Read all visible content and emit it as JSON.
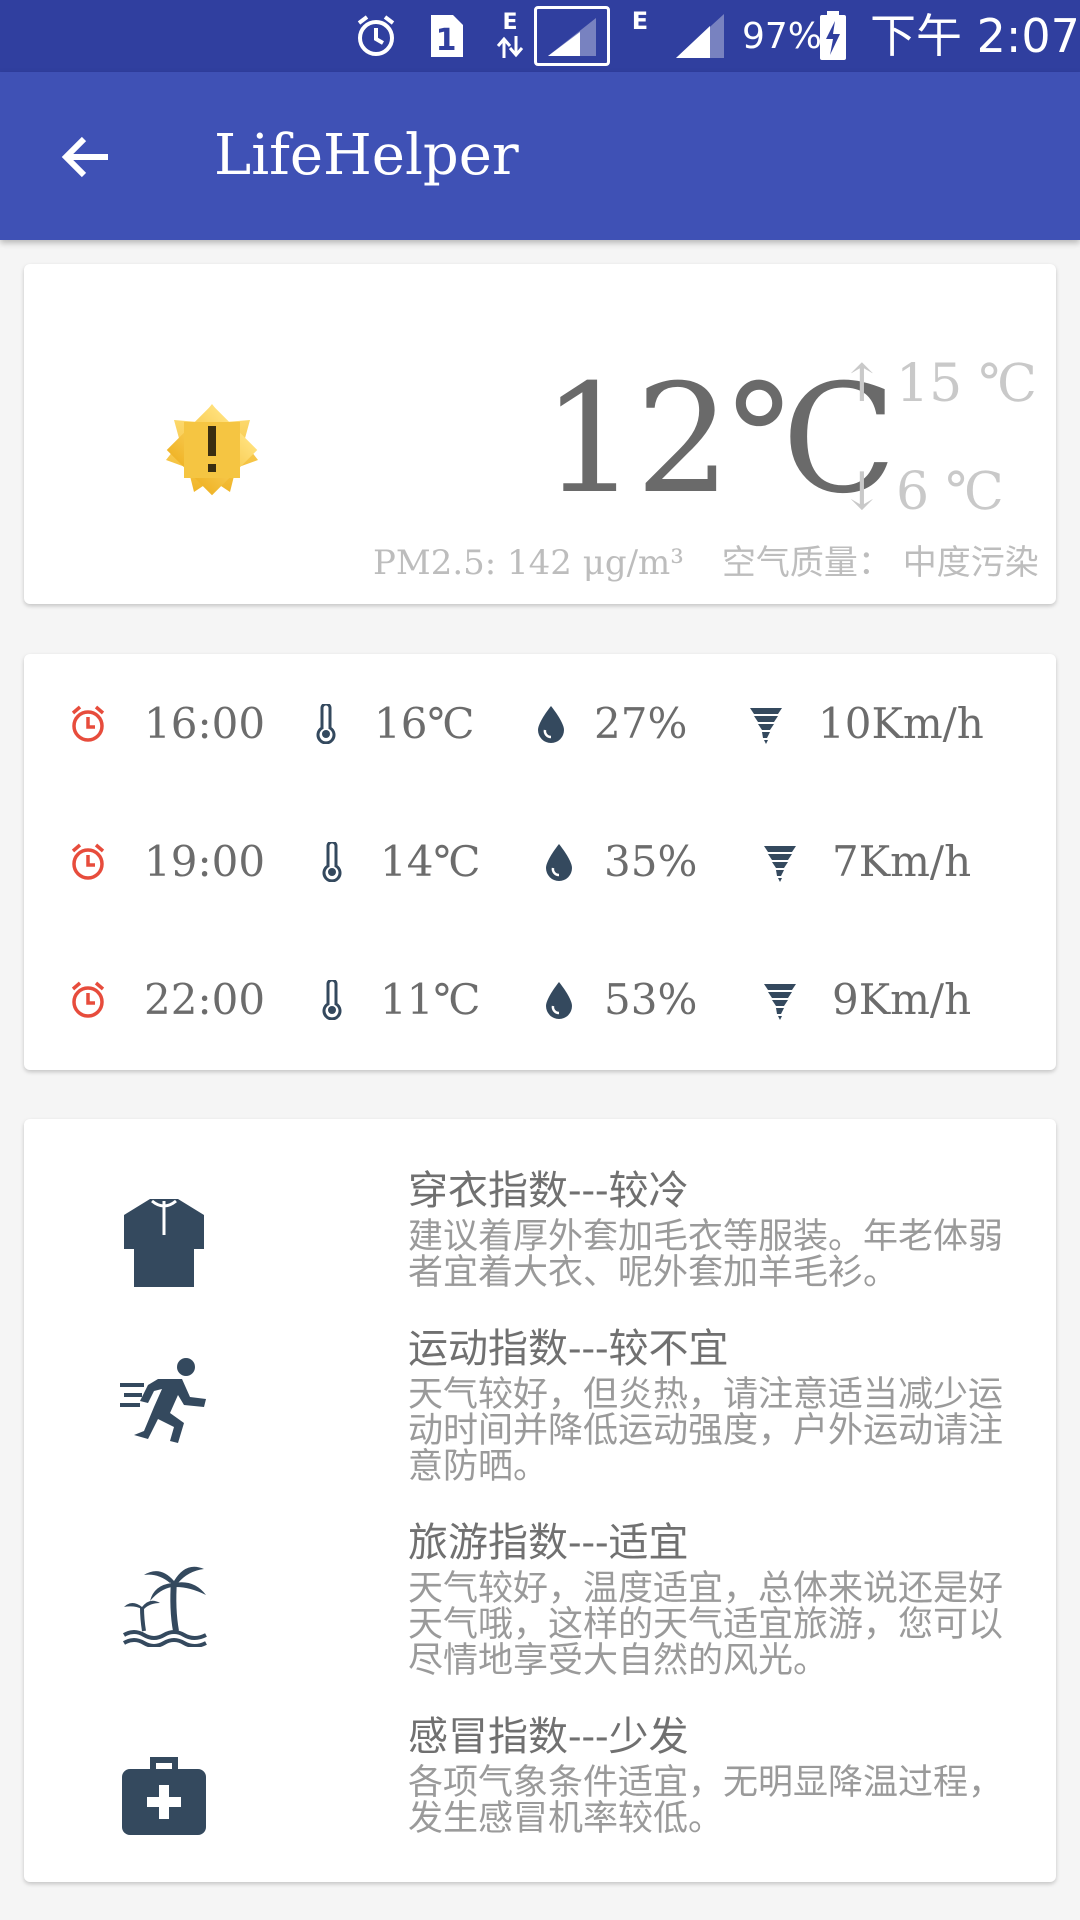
{
  "status_bar": {
    "sim_label": "1",
    "net_type_1": "E",
    "net_type_2": "E",
    "battery": "97%",
    "time": "下午 2:07"
  },
  "app_bar": {
    "title": "LifeHelper"
  },
  "current": {
    "weather_icon": "sun-warning-icon",
    "temperature": "12℃",
    "high_arrow": "↑",
    "high": "15 ℃",
    "low_arrow": "↓",
    "low": "6 ℃",
    "pm25": "PM2.5: 142 μg/m³",
    "air_quality": "空气质量： 中度污染"
  },
  "hourly": [
    {
      "time": "16:00",
      "temp": "16℃",
      "humidity": "27%",
      "wind": "10Km/h"
    },
    {
      "time": "19:00",
      "temp": "14℃",
      "humidity": "35%",
      "wind": "7Km/h"
    },
    {
      "time": "22:00",
      "temp": "11℃",
      "humidity": "53%",
      "wind": "9Km/h"
    }
  ],
  "indices": [
    {
      "icon": "shirt-icon",
      "title": "穿衣指数---较冷",
      "desc": "建议着厚外套加毛衣等服装。年老体弱者宜着大衣、呢外套加羊毛衫。"
    },
    {
      "icon": "running-icon",
      "title": "运动指数---较不宜",
      "desc": "天气较好，但炎热，请注意适当减少运动时间并降低运动强度，户外运动请注意防晒。"
    },
    {
      "icon": "island-icon",
      "title": "旅游指数---适宜",
      "desc": "天气较好，温度适宜，总体来说还是好天气哦，这样的天气适宜旅游，您可以尽情地享受大自然的风光。"
    },
    {
      "icon": "medkit-icon",
      "title": "感冒指数---少发",
      "desc": "各项气象条件适宜，无明显降温过程，发生感冒机率较低。"
    }
  ],
  "colors": {
    "status_bar": "#303f9f",
    "app_bar": "#3f51b5",
    "alarm_red": "#e74c3c",
    "icon_dark": "#34495e"
  }
}
